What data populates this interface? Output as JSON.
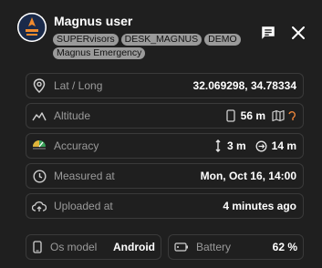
{
  "header": {
    "user_name": "Magnus user",
    "tags": [
      "SUPERvisors",
      "DESK_MAGNUS",
      "DEMO",
      "Magnus Emergency"
    ],
    "avatar_icon": "magnus-logo-icon",
    "chat_icon": "chat-icon",
    "close_icon": "close-icon"
  },
  "rows": {
    "location": {
      "label": "Lat / Long",
      "value": "32.069298, 34.78334",
      "icon": "location-pin-icon"
    },
    "altitude": {
      "label": "Altitude",
      "value": "56 m",
      "icon": "altitude-icon",
      "phone_icon": "phone-icon",
      "map_icon": "map-icon",
      "refresh_icon": "refresh-icon"
    },
    "accuracy": {
      "label": "Accuracy",
      "vertical_value": "3 m",
      "horizontal_value": "14 m",
      "icon": "accuracy-icon"
    },
    "measured": {
      "label": "Measured at",
      "value": "Mon, Oct 16, 14:00",
      "icon": "clock-icon"
    },
    "uploaded": {
      "label": "Uploaded at",
      "value": "4 minutes ago",
      "icon": "cloud-upload-icon"
    }
  },
  "device": {
    "os": {
      "label": "Os model",
      "value": "Android",
      "icon": "phone-icon"
    },
    "battery": {
      "label": "Battery",
      "value": "62 %",
      "icon": "battery-icon"
    }
  },
  "colors": {
    "background": "#1f1f1f",
    "border": "#3a3a3a",
    "tag_bg": "#9a9a9a",
    "label": "#9b9b9b",
    "value": "#ffffff",
    "refresh_accent": "#e8833a"
  }
}
